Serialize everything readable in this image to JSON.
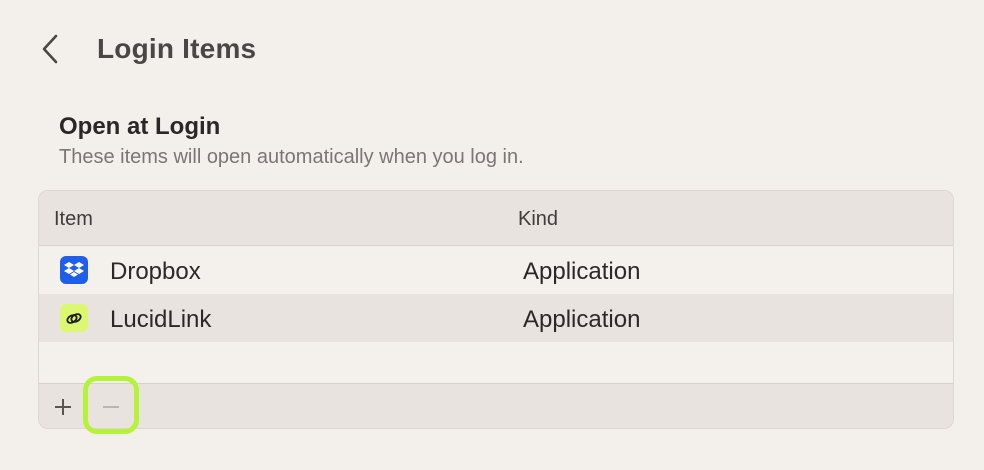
{
  "header": {
    "title": "Login Items",
    "back_icon": "chevron-left-icon"
  },
  "section": {
    "title": "Open at Login",
    "subtitle": "These items will open automatically when you log in."
  },
  "table": {
    "columns": [
      "Item",
      "Kind"
    ],
    "rows": [
      {
        "name": "Dropbox",
        "kind": "Application",
        "icon": "dropbox-icon",
        "icon_color": "#1f5ee8"
      },
      {
        "name": "LucidLink",
        "kind": "Application",
        "icon": "lucidlink-icon",
        "icon_color": "#dcf871"
      }
    ]
  },
  "toolbar": {
    "add_icon": "plus-icon",
    "remove_icon": "minus-icon",
    "highlight_color": "#b6f23a"
  }
}
